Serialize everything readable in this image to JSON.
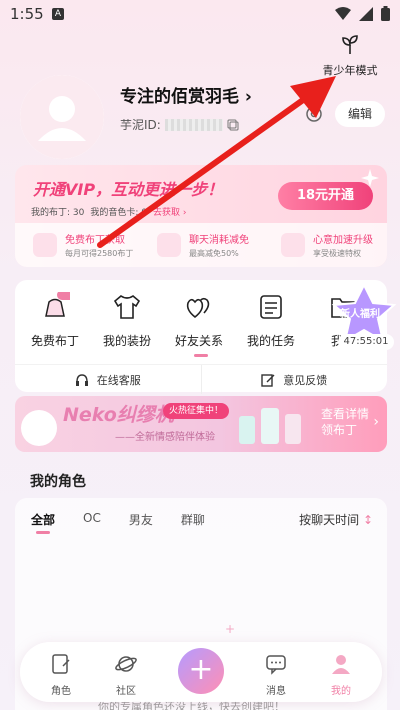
{
  "status_bar": {
    "time": "1:55",
    "a_badge": "A"
  },
  "youth_mode": {
    "label": "青少年模式"
  },
  "profile": {
    "username": "专注的佰赏羽毛",
    "username_chevron": "›",
    "uid_label": "芋泥ID:",
    "edit_label": "编辑"
  },
  "vip": {
    "title": "开通VIP，互动更进一步！",
    "pudding_text": "我的布丁: 30",
    "voice_text": "我的音色卡: 0",
    "get_link": "去获取 ›",
    "open_button": "18元开通",
    "perks": [
      {
        "title": "免费布丁获取",
        "desc": "每月可得2580布丁"
      },
      {
        "title": "聊天消耗减免",
        "desc": "最高减免50%"
      },
      {
        "title": "心意加速升级",
        "desc": "享受极速特权"
      }
    ]
  },
  "quick": {
    "items": [
      {
        "label": "免费布丁",
        "icon": "pudding-icon",
        "badge": "免费"
      },
      {
        "label": "我的装扮",
        "icon": "tshirt-icon"
      },
      {
        "label": "好友关系",
        "icon": "hearts-icon"
      },
      {
        "label": "我的任务",
        "icon": "task-list-icon"
      },
      {
        "label": "我的",
        "icon": "folder-icon"
      }
    ],
    "support_label": "在线客服",
    "feedback_label": "意见反馈"
  },
  "new_user": {
    "label": "新人福利",
    "timer": "47:55:01"
  },
  "banner": {
    "brand": "Neko纠缪机",
    "badge": "火热征集中！",
    "subtitle": "——全新情感陪伴体验",
    "cta_line1": "查看详情",
    "cta_line2": "领布丁"
  },
  "roles": {
    "title": "我的角色",
    "tabs": [
      "全部",
      "OC",
      "男友",
      "群聊"
    ],
    "active_tab": "全部",
    "sort_label": "按聊天时间",
    "empty_text": "你的专属角色还没上线，快去创建吧！"
  },
  "bottom_nav": {
    "items": [
      {
        "label": "角色",
        "icon": "role-card-icon"
      },
      {
        "label": "社区",
        "icon": "planet-icon"
      },
      {
        "label": "消息",
        "icon": "chat-bubble-icon"
      },
      {
        "label": "我的",
        "icon": "person-icon",
        "active": true
      }
    ],
    "plus": "+"
  },
  "colors": {
    "accent": "#f0427a",
    "accent_light": "#f07fa5",
    "annotation": "#e8201c"
  }
}
